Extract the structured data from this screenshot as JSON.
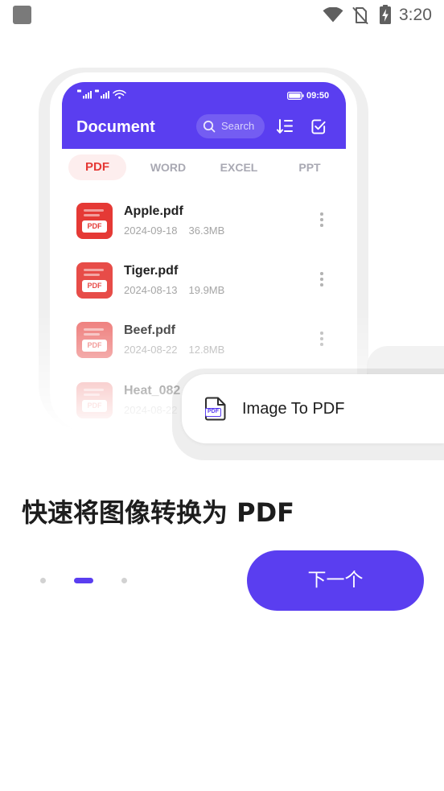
{
  "status_bar": {
    "time": "3:20",
    "icons": [
      "app-notification-icon",
      "wifi-icon",
      "no-sim-icon",
      "battery-charging-icon"
    ]
  },
  "mockup": {
    "status_time": "09:50",
    "header_title": "Document",
    "search_placeholder": "Search",
    "tabs": [
      {
        "label": "PDF",
        "active": true
      },
      {
        "label": "WORD",
        "active": false
      },
      {
        "label": "EXCEL",
        "active": false
      },
      {
        "label": "PPT",
        "active": false
      }
    ],
    "files": [
      {
        "name": "Apple.pdf",
        "date": "2024-09-18",
        "size": "36.3MB",
        "icon_label": "PDF"
      },
      {
        "name": "Tiger.pdf",
        "date": "2024-08-13",
        "size": "19.9MB",
        "icon_label": "PDF"
      },
      {
        "name": "Beef.pdf",
        "date": "2024-08-22",
        "size": "12.8MB",
        "icon_label": "PDF"
      },
      {
        "name": "Heat_082",
        "date": "2024-08-22",
        "icon_label": "PDF"
      }
    ]
  },
  "feature_card": {
    "label": "Image To PDF",
    "icon_label": "PDF"
  },
  "onboarding": {
    "title": "快速将图像转换为 PDF",
    "page_count": 3,
    "active_page": 1,
    "next_button": "下一个"
  },
  "colors": {
    "accent": "#5a3ef0",
    "pdf_red": "#e53935",
    "tab_active_bg": "#fdeeee"
  }
}
